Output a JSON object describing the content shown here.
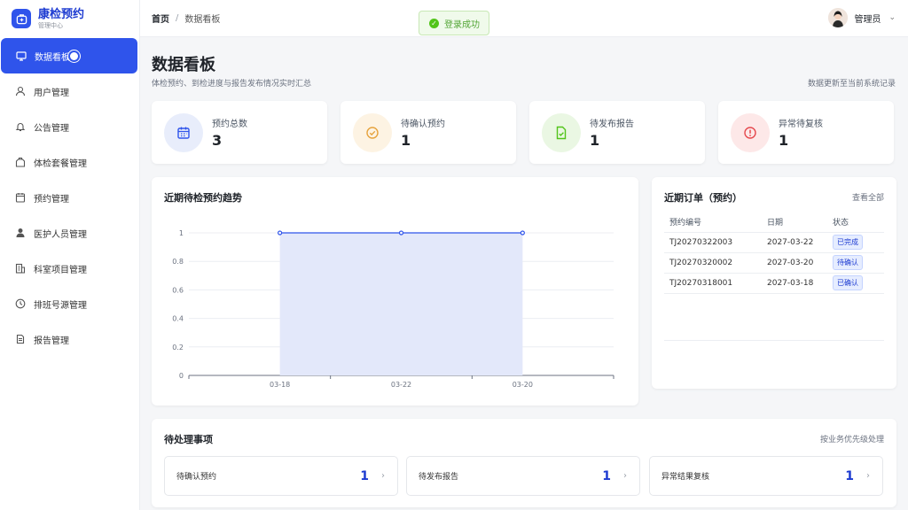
{
  "brand": {
    "title": "康检预约",
    "subtitle": "管理中心"
  },
  "sidebar": {
    "items": [
      {
        "label": "数据看板",
        "icon": "dashboard-icon",
        "active": true
      },
      {
        "label": "用户管理",
        "icon": "user-icon"
      },
      {
        "label": "公告管理",
        "icon": "bell-icon"
      },
      {
        "label": "体检套餐管理",
        "icon": "bag-icon"
      },
      {
        "label": "预约管理",
        "icon": "calendar-icon"
      },
      {
        "label": "医护人员管理",
        "icon": "person-icon"
      },
      {
        "label": "科室项目管理",
        "icon": "building-icon"
      },
      {
        "label": "排班号源管理",
        "icon": "clock-icon"
      },
      {
        "label": "报告管理",
        "icon": "document-icon"
      }
    ]
  },
  "header": {
    "breadcrumb_home": "首页",
    "breadcrumb_sep": "/",
    "breadcrumb_current": "数据看板",
    "toast": "登录成功",
    "user_name": "管理员"
  },
  "page": {
    "title": "数据看板",
    "subtitle": "体检预约、到检进度与报告发布情况实时汇总",
    "note": "数据更新至当前系统记录"
  },
  "stats": [
    {
      "label": "预约总数",
      "value": "3",
      "icon": "calendar-icon",
      "color": "#2f54eb",
      "bg": "#e8edfb"
    },
    {
      "label": "待确认预约",
      "value": "1",
      "icon": "check-circle-icon",
      "color": "#e6a23c",
      "bg": "#fdf3e3"
    },
    {
      "label": "待发布报告",
      "value": "1",
      "icon": "document-check-icon",
      "color": "#52c41a",
      "bg": "#eaf7e3"
    },
    {
      "label": "异常待复核",
      "value": "1",
      "icon": "alert-icon",
      "color": "#e5484d",
      "bg": "#fde8e8"
    }
  ],
  "trend": {
    "title": "近期待检预约趋势"
  },
  "chart_data": {
    "type": "area",
    "title": "近期待检预约趋势",
    "categories": [
      "03-18",
      "03-22",
      "03-20"
    ],
    "values": [
      1,
      1,
      1
    ],
    "y_ticks": [
      "0",
      "0.2",
      "0.4",
      "0.6",
      "0.8",
      "1"
    ],
    "ylim": [
      0,
      1
    ],
    "grid": true,
    "color": "#2f54eb",
    "fill": "#e3e8fa"
  },
  "orders": {
    "title": "近期订单（预约）",
    "link": "查看全部",
    "columns": [
      "预约编号",
      "日期",
      "状态"
    ],
    "rows": [
      {
        "id": "TJ20270322003",
        "date": "2027-03-22",
        "status": "已完成"
      },
      {
        "id": "TJ20270320002",
        "date": "2027-03-20",
        "status": "待确认"
      },
      {
        "id": "TJ20270318001",
        "date": "2027-03-18",
        "status": "已确认"
      }
    ]
  },
  "todos": {
    "title": "待处理事项",
    "note": "按业务优先级处理",
    "items": [
      {
        "label": "待确认预约",
        "value": "1"
      },
      {
        "label": "待发布报告",
        "value": "1"
      },
      {
        "label": "异常结果复核",
        "value": "1"
      }
    ]
  }
}
